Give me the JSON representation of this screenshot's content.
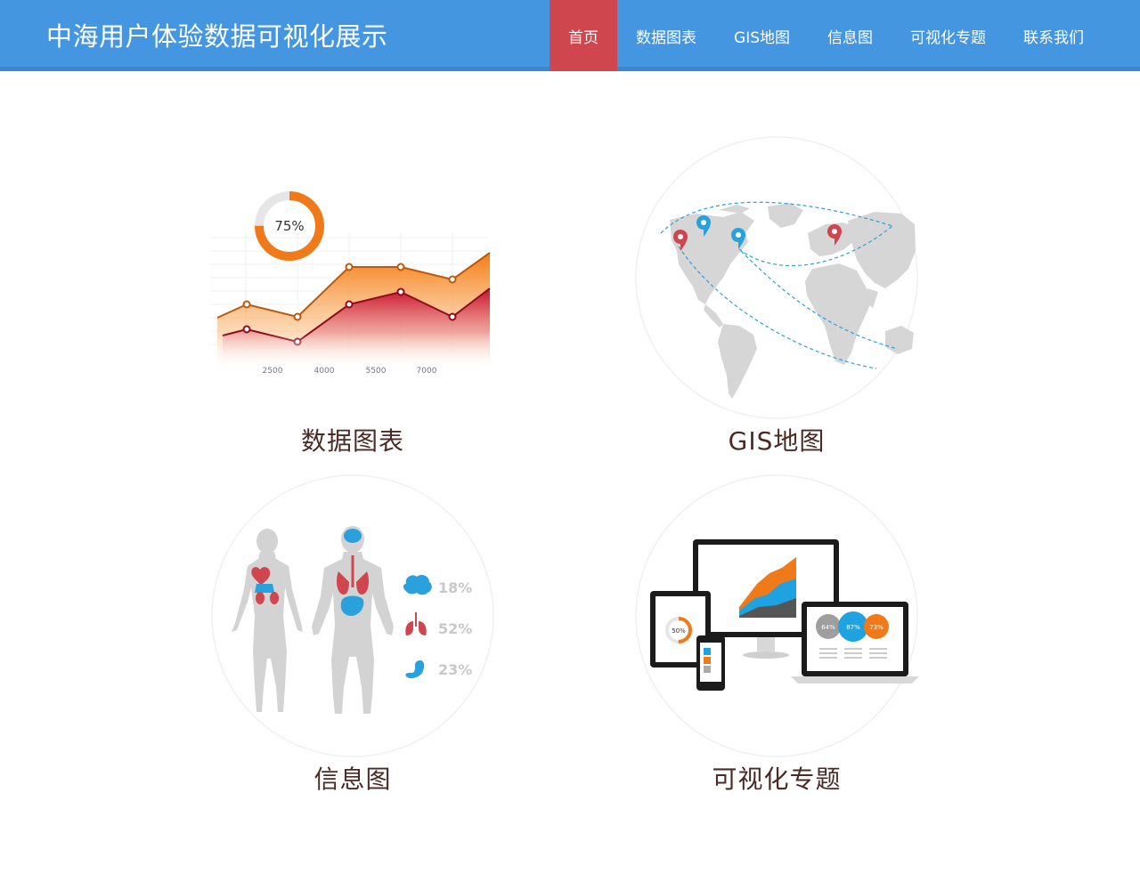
{
  "header": {
    "brand": "中海用户体验数据可视化展示",
    "nav": [
      {
        "label": "首页",
        "active": true
      },
      {
        "label": "数据图表",
        "active": false
      },
      {
        "label": "GIS地图",
        "active": false
      },
      {
        "label": "信息图",
        "active": false
      },
      {
        "label": "可视化专题",
        "active": false
      },
      {
        "label": "联系我们",
        "active": false
      }
    ]
  },
  "cards": {
    "chart": {
      "label": "数据图表",
      "donut_text": "75%",
      "ticks": [
        "2500",
        "4000",
        "5500",
        "7000"
      ]
    },
    "gis": {
      "label": "GIS地图"
    },
    "info": {
      "label": "信息图",
      "stats": [
        {
          "icon": "brain-icon",
          "value": "18%"
        },
        {
          "icon": "lungs-icon",
          "value": "52%"
        },
        {
          "icon": "stomach-icon",
          "value": "23%"
        }
      ]
    },
    "topic": {
      "label": "可视化专题",
      "tablet_text": "50%",
      "bubbles": [
        "64%",
        "87%",
        "73%"
      ]
    }
  },
  "colors": {
    "header": "#4496e0",
    "active": "#d0464e",
    "orange": "#f07a1a",
    "red": "#c8102e",
    "blue": "#1fa3e0"
  }
}
